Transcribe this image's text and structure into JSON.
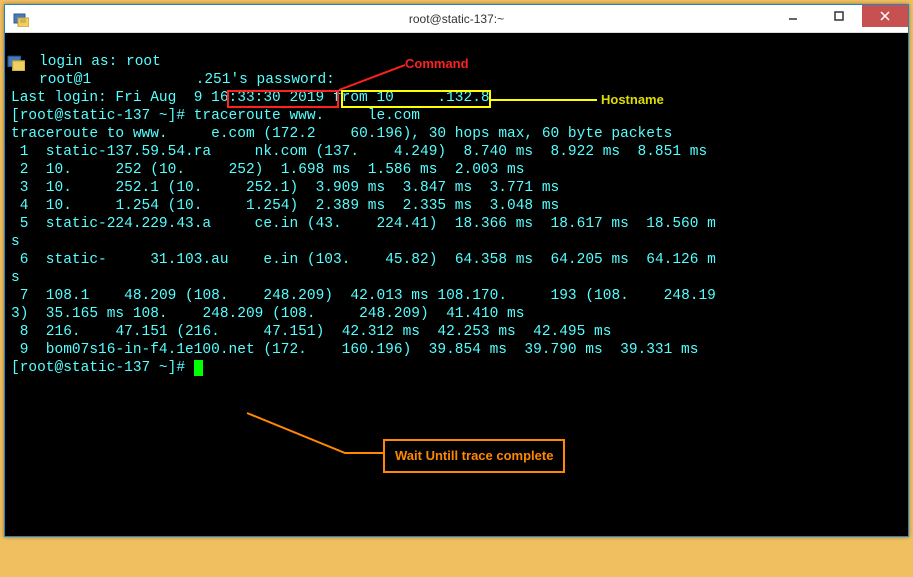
{
  "titlebar": {
    "title": "root@static-137:~"
  },
  "annotations": {
    "command_label": "Command",
    "hostname_label": "Hostname",
    "wait_label": "Wait Untill trace complete"
  },
  "terminal": {
    "line1_a": "login as: root",
    "line2_a": "root@1",
    "line2_b": ".251's password:",
    "line3_a": "Last login: Fri Aug  9 16:33:30 2019 from 10",
    "line3_b": ".132.8",
    "line4_a": "[root@static-137 ~]# ",
    "line4_b": "traceroute ",
    "line4_c": "www.",
    "line4_d": "le.com",
    "line5_a": "traceroute to www.",
    "line5_b": "e.com (172.2",
    "line5_c": "60.196), 30 hops max, 60 byte packets",
    "line6_a": " 1  static-137.59.54.ra",
    "line6_b": "nk.com (137.",
    "line6_c": "4.249)  8.740 ms  8.922 ms  8.851 ms",
    "line7_a": " 2  10.",
    "line7_b": "252 (10.",
    "line7_c": "252)  1.698 ms  1.586 ms  2.003 ms",
    "line8_a": " 3  10.",
    "line8_b": "252.1 (10.",
    "line8_c": "252.1)  3.909 ms  3.847 ms  3.771 ms",
    "line9_a": " 4  10.",
    "line9_b": "1.254 (10.",
    "line9_c": "1.254)  2.389 ms  2.335 ms  3.048 ms",
    "line10_a": " 5  static-224.229.43.a",
    "line10_b": "ce.in (43.",
    "line10_c": "224.41)  18.366 ms  18.617 ms  18.560 m",
    "line10_d": "s",
    "line11_a": " 6  static-",
    "line11_b": "31.103.au",
    "line11_c": "e.in (103.",
    "line11_d": "45.82)  64.358 ms  64.205 ms  64.126 m",
    "line11_e": "s",
    "line12_a": " 7  108.1",
    "line12_b": "48.209 (108.",
    "line12_c": "248.209)  42.013 ms 108.170.",
    "line12_d": "193 (108.",
    "line12_e": "248.19",
    "line13_a": "3)  35.165 ms 108.",
    "line13_b": "248.209 (108.",
    "line13_c": "248.209)  41.410 ms",
    "line14_a": " 8  216.",
    "line14_b": "47.151 (216.",
    "line14_c": "47.151)  42.312 ms  42.253 ms  42.495 ms",
    "line15_a": " 9  bom07s16-in-f4.1e100.net (172.",
    "line15_b": "160.196)  39.854 ms  39.790 ms  39.331 ms",
    "line16_a": "[root@static-137 ~]# "
  }
}
